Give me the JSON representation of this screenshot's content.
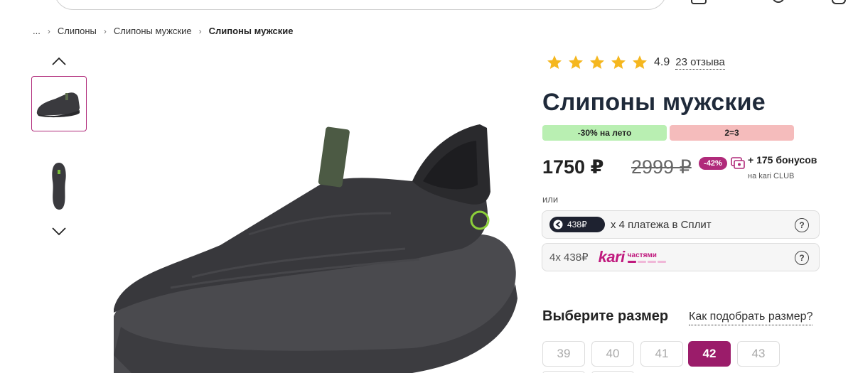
{
  "breadcrumb": {
    "ellipsis": "...",
    "items": [
      "Слипоны",
      "Слипоны мужские",
      "Слипоны мужские"
    ]
  },
  "product": {
    "title": "Слипоны мужские",
    "rating_value": "4.9",
    "rating_stars": 5,
    "reviews_label": "23 отзыва",
    "promo_badges": [
      "-30% на лето",
      "2=3"
    ],
    "price": "1750 ₽",
    "old_price": "2999 ₽",
    "discount": "-42%",
    "bonus": "+ 175 бонусов",
    "bonus_sub": "на kari CLUB"
  },
  "payment": {
    "or_label": "или",
    "split_amount": "438₽",
    "split_text": "x 4 платежа в Сплит",
    "parts_text": "4x 438₽",
    "parts_brand": "kari",
    "parts_brand_sub": "частями",
    "help_glyph": "?"
  },
  "sizes": {
    "title": "Выберите размер",
    "guide_link": "Как подобрать размер?",
    "options": [
      "39",
      "40",
      "41",
      "42",
      "43"
    ],
    "selected": "42"
  },
  "colors": {
    "accent": "#9b1c6a",
    "kari_brand": "#c01a7e",
    "star": "#f5b71f",
    "badge_green": "#b9efb2",
    "badge_red": "#f5bcbc"
  },
  "icons": {
    "thumb_up": "chevron-up-icon",
    "thumb_down": "chevron-down-icon",
    "star": "star-icon",
    "bonus": "bonus-card-icon",
    "split": "split-logo-icon",
    "help": "question-circle-icon"
  }
}
